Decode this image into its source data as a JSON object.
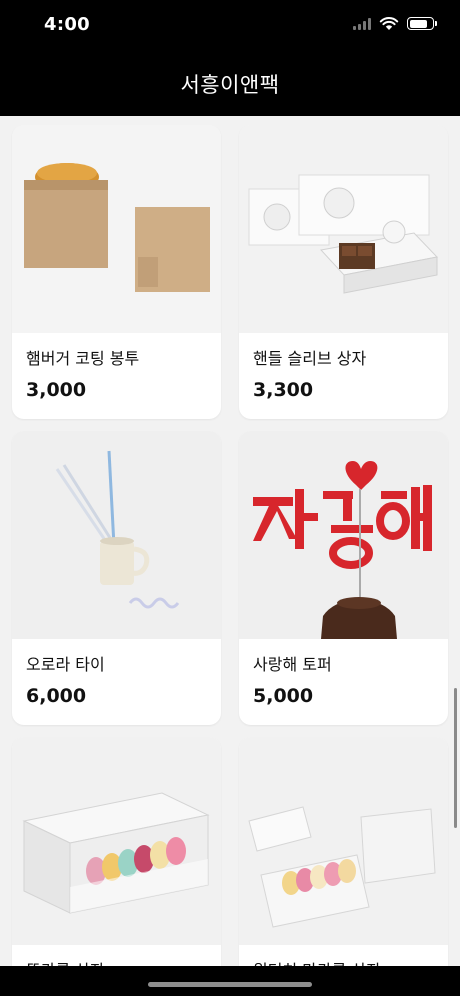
{
  "status": {
    "time": "4:00",
    "battery_level": 0.85
  },
  "header": {
    "title": "서흥이앤팩"
  },
  "products": [
    {
      "name": "햄버거 코팅 봉투",
      "price": "3,000",
      "image": "burger-kraft-bags"
    },
    {
      "name": "핸들 슬리브 상자",
      "price": "3,300",
      "image": "handle-sleeve-box"
    },
    {
      "name": "오로라 타이",
      "price": "6,000",
      "image": "aurora-tie-straws"
    },
    {
      "name": "사랑해 토퍼",
      "price": "5,000",
      "image": "love-cake-topper"
    },
    {
      "name": "뚜카롱 상자",
      "price": "",
      "image": "macaron-box-white"
    },
    {
      "name": "원터치 마카롱 상자",
      "price": "",
      "image": "one-touch-macaron-box"
    }
  ],
  "colors": {
    "bar": "#000000",
    "background": "#f2f2f2",
    "card": "#ffffff",
    "topper_red": "#d7262c"
  }
}
